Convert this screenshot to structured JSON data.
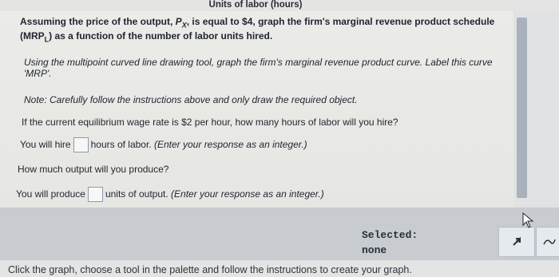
{
  "header": {
    "units_label": "Units of labor (hours)"
  },
  "question": {
    "line1_pre": "Assuming the price of the output, ",
    "price_symbol": "P",
    "price_sub": "X",
    "line1_post": ", is equal to $4, graph the firm's marginal revenue product schedule",
    "line2_pre": "(MRP",
    "line2_sub": "L",
    "line2_post": ") as a function of the number of labor units hired.",
    "tool_instruction_line1": "Using the multipoint curved line drawing tool, graph the firm's marginal revenue product curve. Label this curve",
    "tool_instruction_line2": "'MRP'.",
    "note": "Note: Carefully follow the instructions above and only draw the required object.",
    "wage_question": "If the current equilibrium wage rate is $2 per hour, how many hours of labor will you hire?",
    "hire_prefix": "You will hire",
    "hire_suffix": "hours of labor.",
    "hire_hint": "(Enter your response as an integer.)",
    "hire_value": "",
    "output_question": "How much output will you produce?",
    "produce_prefix": "You will produce",
    "produce_suffix": "units of output.",
    "produce_hint": "(Enter your response as an integer.)",
    "produce_value": ""
  },
  "palette": {
    "selected_label": "Selected:",
    "selected_value": "none",
    "tools": [
      "select-arrow-icon",
      "curve-tool-icon"
    ]
  },
  "footer": {
    "instruction": "Click the graph, choose a tool in the palette and follow the instructions to create your graph."
  }
}
